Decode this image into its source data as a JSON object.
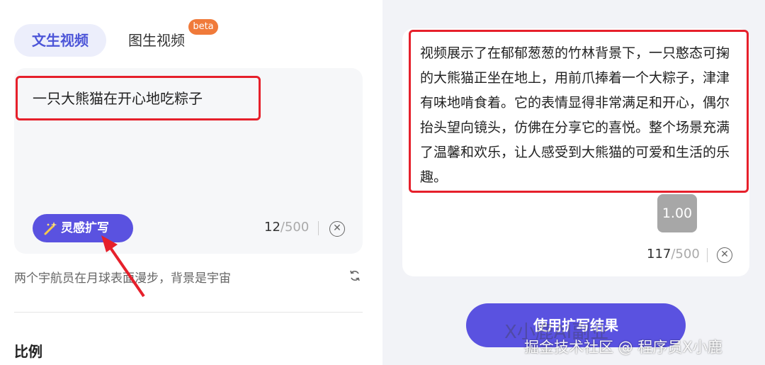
{
  "tabs": {
    "text_to_video": "文生视频",
    "image_to_video": "图生视频",
    "beta_badge": "beta"
  },
  "prompt": {
    "value": "一只大熊猫在开心地吃粽子",
    "count_current": "12",
    "count_max": "/500",
    "inspire_button": "灵感扩写"
  },
  "sample_prompt": "两个宇航员在月球表面漫步，背景是宇宙",
  "section_ratio": "比例",
  "result": {
    "text": "视频展示了在郁郁葱葱的竹林背景下，一只憨态可掬的大熊猫正坐在地上，用前爪捧着一个大粽子，津津有味地啃食着。它的表情显得非常满足和开心，偶尔抬头望向镜头，仿佛在分享它的喜悦。整个场景充满了温馨和欢乐，让人感受到大熊猫的可爱和生活的乐趣。",
    "speed": "1.00",
    "count_current": "117",
    "count_max": "/500",
    "use_button": "使用扩写结果"
  },
  "watermarks": {
    "wechat": "X小鹿AI副业",
    "juejin": "掘金技术社区 @ 程序员X小鹿"
  },
  "icons": {
    "clear": "close-circle-icon",
    "refresh": "refresh-icon",
    "wand": "magic-wand-icon"
  },
  "colors": {
    "accent": "#5a52e0",
    "highlight": "#e6202b",
    "badge": "#f07a3a"
  }
}
